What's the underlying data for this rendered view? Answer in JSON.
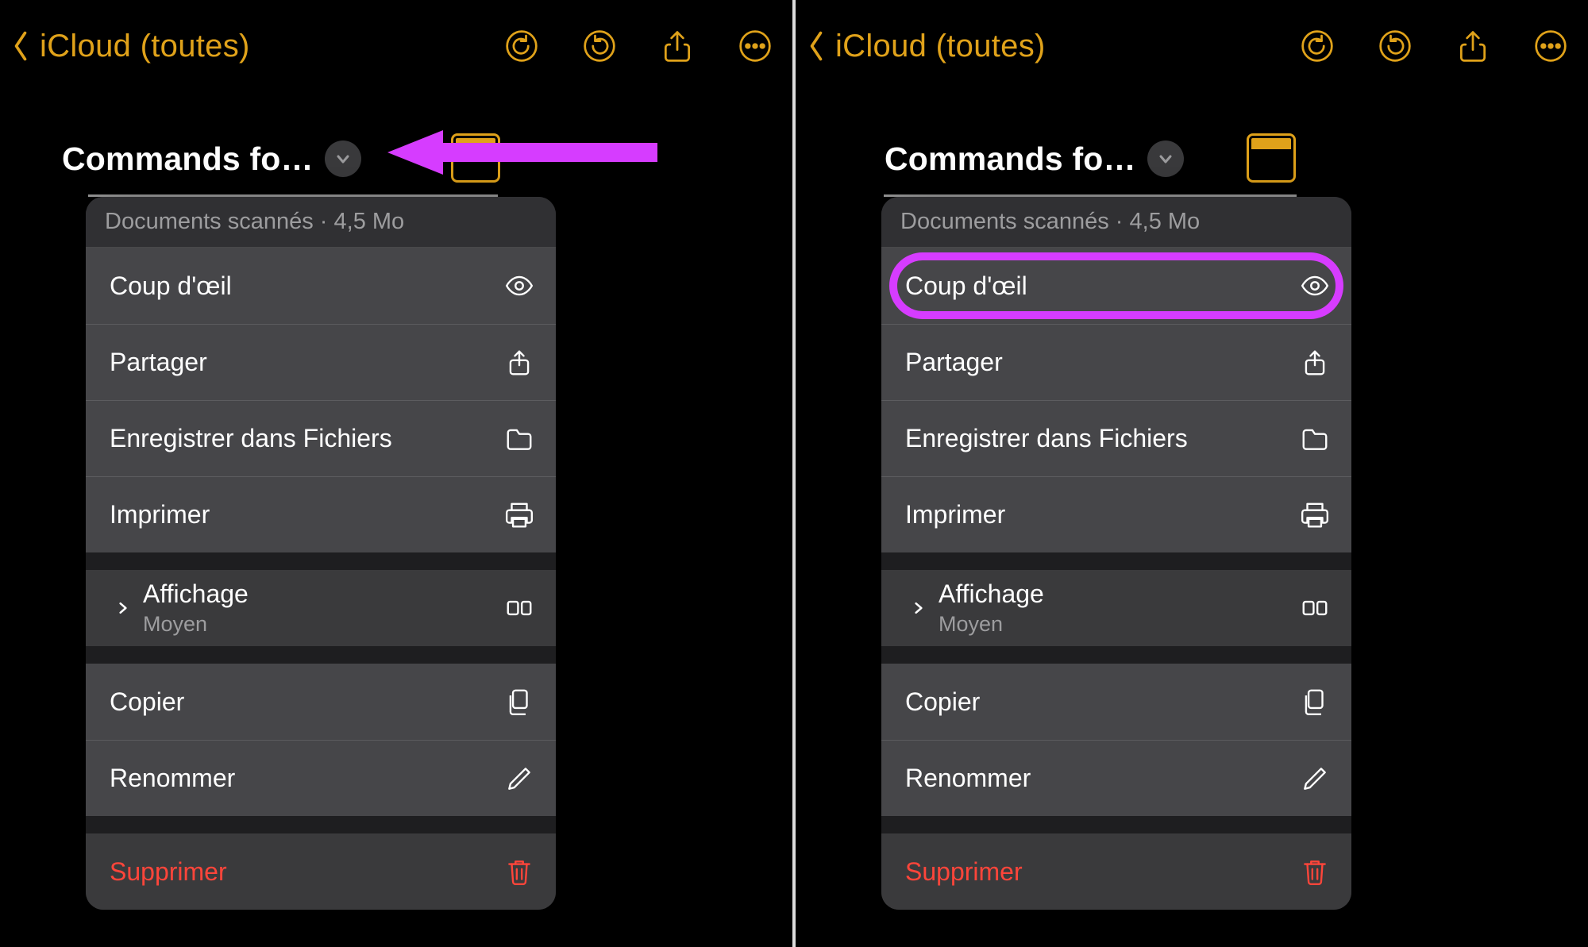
{
  "nav": {
    "back_label": "iCloud (toutes)"
  },
  "note": {
    "title": "Commands fo…"
  },
  "menu": {
    "header": "Documents scannés · 4,5 Mo",
    "items": {
      "quicklook": "Coup d'œil",
      "share": "Partager",
      "save_files": "Enregistrer dans Fichiers",
      "print": "Imprimer",
      "view_main": "Affichage",
      "view_sub": "Moyen",
      "copy": "Copier",
      "rename": "Renommer",
      "delete": "Supprimer"
    }
  }
}
